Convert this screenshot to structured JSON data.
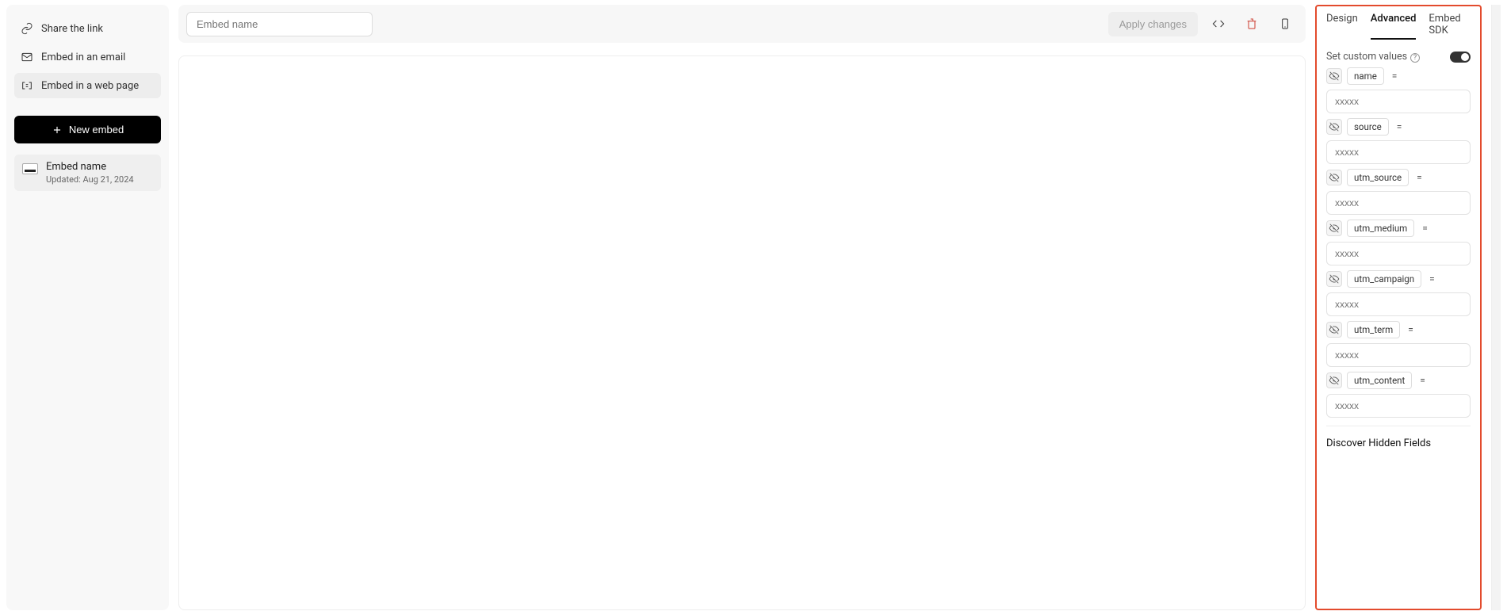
{
  "sidebar": {
    "items": [
      {
        "label": "Share the link"
      },
      {
        "label": "Embed in an email"
      },
      {
        "label": "Embed in a web page"
      }
    ],
    "new_embed_label": "New embed",
    "selected_embed": {
      "title": "Embed name",
      "subtitle": "Updated: Aug 21, 2024"
    }
  },
  "topbar": {
    "embed_name_placeholder": "Embed name",
    "apply_label": "Apply changes"
  },
  "rpanel": {
    "tabs": {
      "design": "Design",
      "advanced": "Advanced",
      "embed_sdk": "Embed SDK"
    },
    "set_custom_label": "Set custom values",
    "toggle_on": true,
    "fields": [
      {
        "name": "name",
        "placeholder": "xxxxx"
      },
      {
        "name": "source",
        "placeholder": "xxxxx"
      },
      {
        "name": "utm_source",
        "placeholder": "xxxxx"
      },
      {
        "name": "utm_medium",
        "placeholder": "xxxxx"
      },
      {
        "name": "utm_campaign",
        "placeholder": "xxxxx"
      },
      {
        "name": "utm_term",
        "placeholder": "xxxxx"
      },
      {
        "name": "utm_content",
        "placeholder": "xxxxx"
      }
    ],
    "discover_label": "Discover Hidden Fields"
  }
}
